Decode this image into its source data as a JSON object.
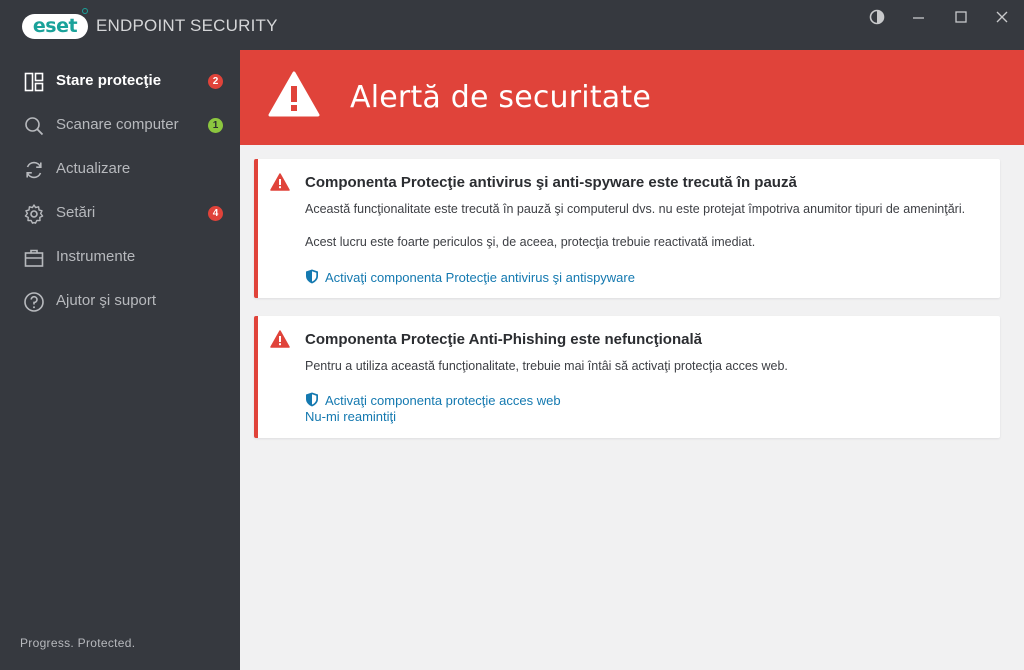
{
  "app": {
    "logo_text": "eset",
    "product_name": "ENDPOINT SECURITY"
  },
  "window_controls": {
    "theme_icon": "contrast-icon",
    "minimize_icon": "minimize-icon",
    "maximize_icon": "maximize-icon",
    "close_icon": "close-icon"
  },
  "sidebar": {
    "items": [
      {
        "label": "Stare protecţie",
        "icon": "dashboard-icon",
        "badge": "2",
        "active": true
      },
      {
        "label": "Scanare computer",
        "icon": "search-icon",
        "badge": "1"
      },
      {
        "label": "Actualizare",
        "icon": "refresh-icon"
      },
      {
        "label": "Setări",
        "icon": "gear-icon",
        "badge": "4"
      },
      {
        "label": "Instrumente",
        "icon": "briefcase-icon"
      },
      {
        "label": "Ajutor şi suport",
        "icon": "help-icon"
      }
    ],
    "footer": "Progress. Protected."
  },
  "alert": {
    "title": "Alertă de securitate",
    "icon": "warning-icon"
  },
  "cards": [
    {
      "title": "Componenta Protecţie antivirus şi anti-spyware este trecută în pauză",
      "text_line1": "Această funcţionalitate este trecută în pauză şi computerul dvs. nu este protejat împotriva anumitor tipuri de ameninţări.",
      "text_line2": "Acest lucru este foarte periculos şi, de aceea, protecţia trebuie reactivată imediat.",
      "link": "Activaţi componenta Protecţie antivirus şi antispyware"
    },
    {
      "title": "Componenta Protecţie Anti-Phishing este nefuncţională",
      "text_line1": "Pentru a utiliza această funcţionalitate, trebuie mai întâi să activaţi protecţia acces web.",
      "link": "Activaţi componenta protecţie acces web",
      "link2": "Nu-mi reamintiţi"
    }
  ],
  "colors": {
    "sidebar_bg": "#36393f",
    "alert_red": "#e0433a",
    "link_blue": "#1479b0",
    "brand_teal": "#1aa29a",
    "badge_green": "#8cc63f"
  }
}
